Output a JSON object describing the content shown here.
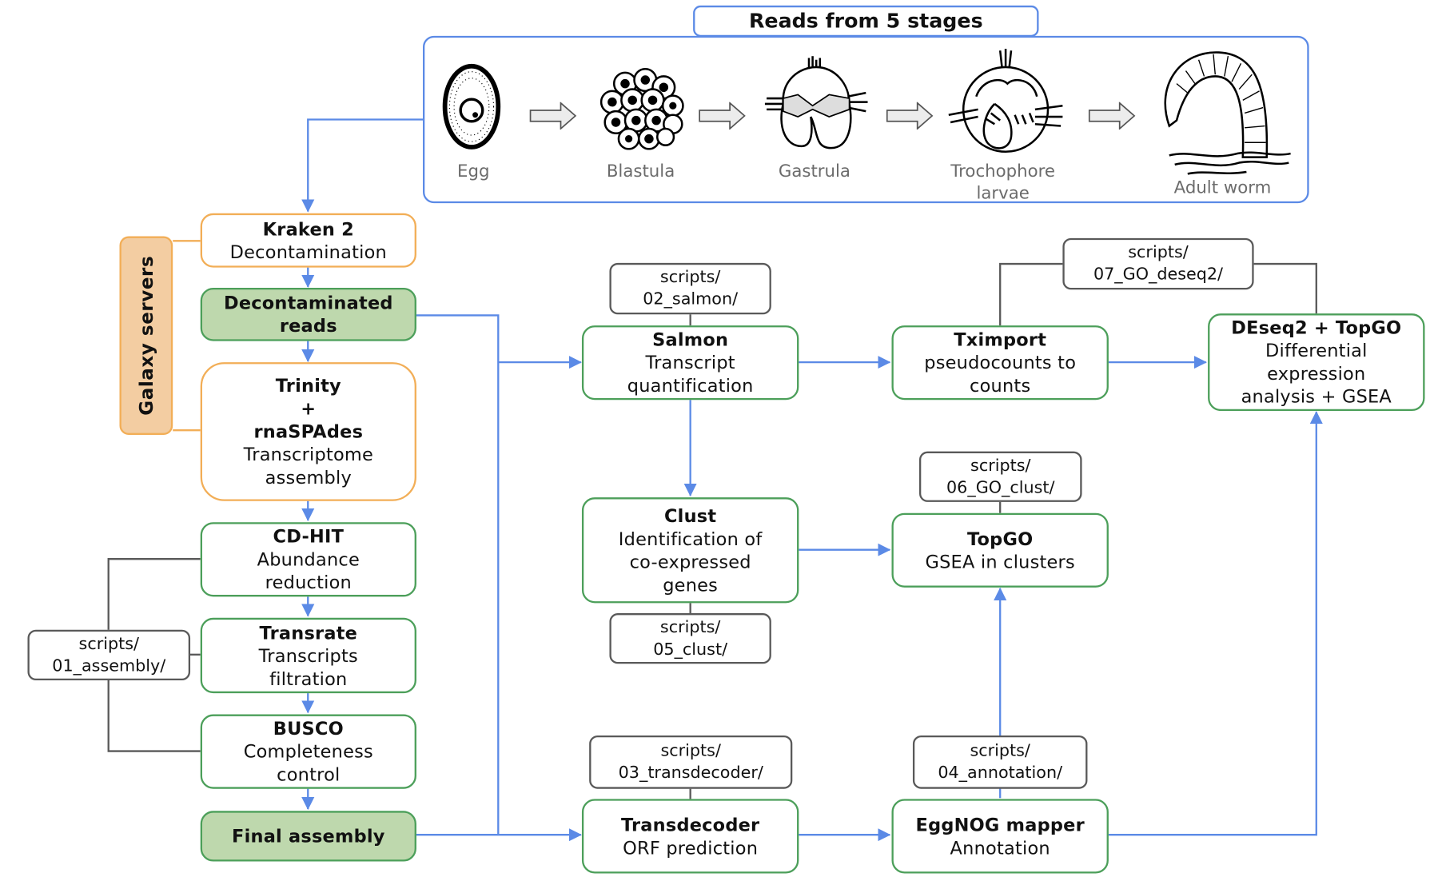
{
  "reads_panel": {
    "title": "Reads from 5 stages",
    "stages": [
      {
        "label": "Egg",
        "icon": "egg-illustration"
      },
      {
        "label": "Blastula",
        "icon": "blastula-illustration"
      },
      {
        "label": "Gastrula",
        "icon": "gastrula-illustration"
      },
      {
        "label": "Trochophore larvae",
        "label_line1": "Trochophore",
        "label_line2": "larvae",
        "icon": "trochophore-illustration"
      },
      {
        "label": "Adult worm",
        "icon": "adult-worm-illustration"
      }
    ]
  },
  "galaxy_group": {
    "label": "Galaxy servers",
    "color": "#f3cda2"
  },
  "nodes": {
    "kraken": {
      "title": "Kraken 2",
      "lines": [
        "Decontamination"
      ]
    },
    "decontaminated": {
      "title_lines": [
        "Decontaminated",
        "reads"
      ]
    },
    "trinity": {
      "title_lines": [
        "Trinity",
        "+",
        "rnaSPAdes"
      ],
      "lines": [
        "Transcriptome",
        "assembly"
      ]
    },
    "cdhit": {
      "title": "CD-HIT",
      "lines": [
        "Abundance",
        "reduction"
      ]
    },
    "transrate": {
      "title": "Transrate",
      "lines": [
        "Transcripts",
        "filtration"
      ]
    },
    "busco": {
      "title": "BUSCO",
      "lines": [
        "Completeness",
        "control"
      ]
    },
    "final": {
      "title": "Final assembly"
    },
    "salmon": {
      "title": "Salmon",
      "lines": [
        "Transcript",
        "quantification"
      ]
    },
    "tximport": {
      "title": "Tximport",
      "lines": [
        "pseudocounts to",
        "counts"
      ]
    },
    "deseq": {
      "title": "DEseq2 + TopGO",
      "lines": [
        "Differential",
        "expression",
        "analysis + GSEA"
      ]
    },
    "clust": {
      "title": "Clust",
      "lines": [
        "Identification of",
        "co-expressed",
        "genes"
      ]
    },
    "topgo": {
      "title": "TopGO",
      "lines": [
        "GSEA in clusters"
      ]
    },
    "transdecoder": {
      "title": "Transdecoder",
      "lines": [
        "ORF prediction"
      ]
    },
    "eggnog": {
      "title": "EggNOG mapper",
      "lines": [
        "Annotation"
      ]
    }
  },
  "scripts": {
    "s01": [
      "scripts/",
      "01_assembly/"
    ],
    "s02": [
      "scripts/",
      "02_salmon/"
    ],
    "s03": [
      "scripts/",
      "03_transdecoder/"
    ],
    "s04": [
      "scripts/",
      "04_annotation/"
    ],
    "s05": [
      "scripts/",
      "05_clust/"
    ],
    "s06": [
      "scripts/",
      "06_GO_clust/"
    ],
    "s07": [
      "scripts/",
      "07_GO_deseq2/"
    ]
  },
  "colors": {
    "flow_arrow": "#5b8ae6",
    "script_link": "#595959",
    "galaxy_border": "#f2ae57",
    "tool_border": "#4c9f5a",
    "data_fill": "#bed8ad"
  }
}
